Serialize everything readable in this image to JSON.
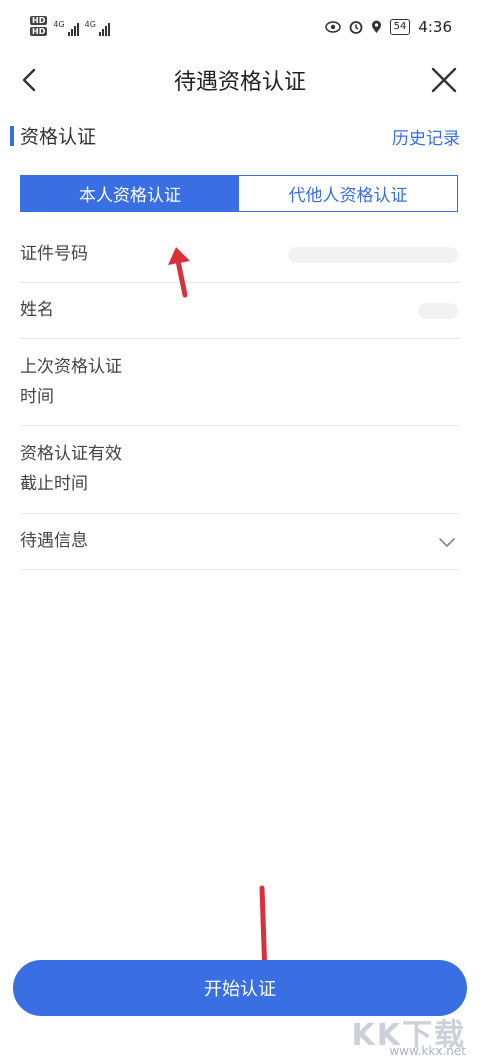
{
  "status_bar": {
    "hd1": "HD",
    "hd2": "HD",
    "net1": "4G",
    "net2": "4G",
    "battery": "54",
    "time": "4:36",
    "icons": [
      "eye-icon",
      "alarm-icon",
      "location-icon"
    ]
  },
  "header": {
    "title": "待遇资格认证",
    "back_icon": "chevron-left-icon",
    "close_icon": "close-icon"
  },
  "section": {
    "title": "资格认证",
    "history_link": "历史记录"
  },
  "tabs": [
    {
      "label": "本人资格认证",
      "active": true
    },
    {
      "label": "代他人资格认证",
      "active": false
    }
  ],
  "fields": [
    {
      "label": "证件号码"
    },
    {
      "label": "姓名"
    },
    {
      "label_line1": "上次资格认证",
      "label_line2": "时间"
    },
    {
      "label_line1": "资格认证有效",
      "label_line2": "截止时间"
    },
    {
      "label": "待遇信息",
      "icon": "chevron-down-icon"
    }
  ],
  "start_button": "开始认证",
  "watermark": {
    "letters": "KK下载",
    "url": "www.kkx.net"
  },
  "colors": {
    "accent": "#3a6fe3",
    "annotation_arrow": "#d9303e"
  }
}
